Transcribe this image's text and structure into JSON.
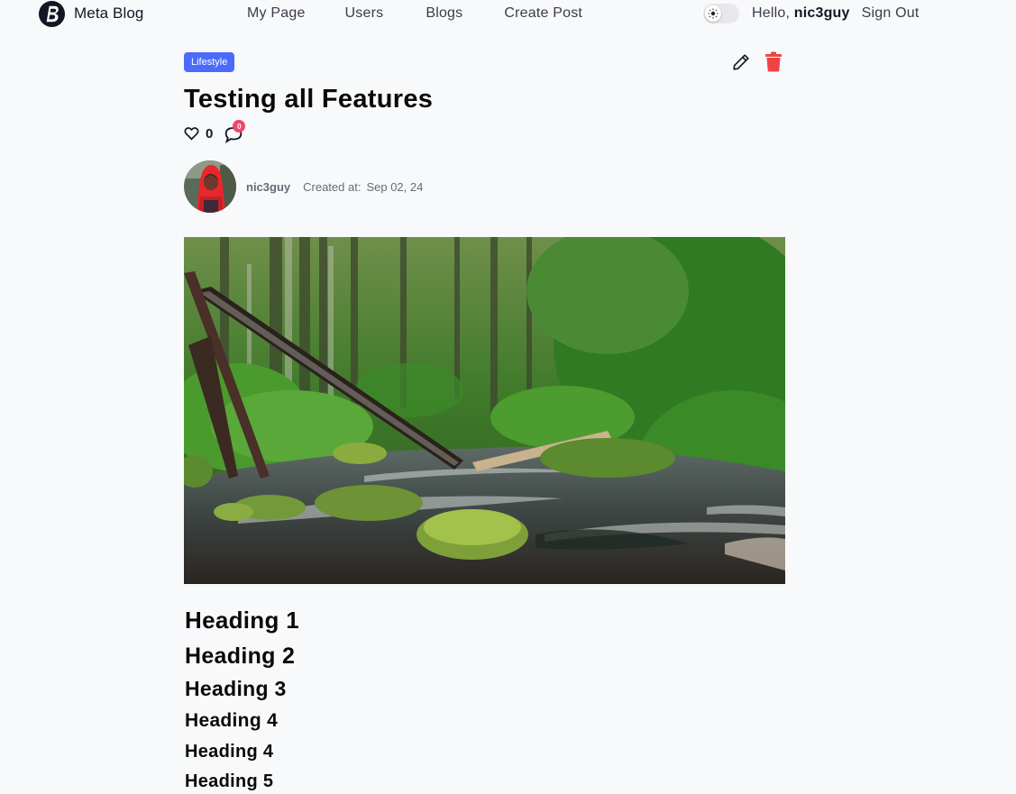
{
  "nav": {
    "brand": "Meta Blog",
    "links": [
      "My Page",
      "Users",
      "Blogs",
      "Create Post"
    ],
    "greeting": "Hello, ",
    "username": "nic3guy",
    "sign_out": "Sign Out"
  },
  "post": {
    "category": "Lifestyle",
    "title": "Testing all Features",
    "likes": "0",
    "comments": "0",
    "author": "nic3guy",
    "created_label": "Created at:",
    "created_date": "Sep 02, 24"
  },
  "content": {
    "headings": [
      "Heading 1",
      "Heading 2",
      "Heading 3",
      "Heading 4",
      "Heading 4",
      "Heading 5"
    ]
  },
  "colors": {
    "accent": "#4b6bfb",
    "delete": "#ef4444",
    "badge": "#f0476a"
  }
}
